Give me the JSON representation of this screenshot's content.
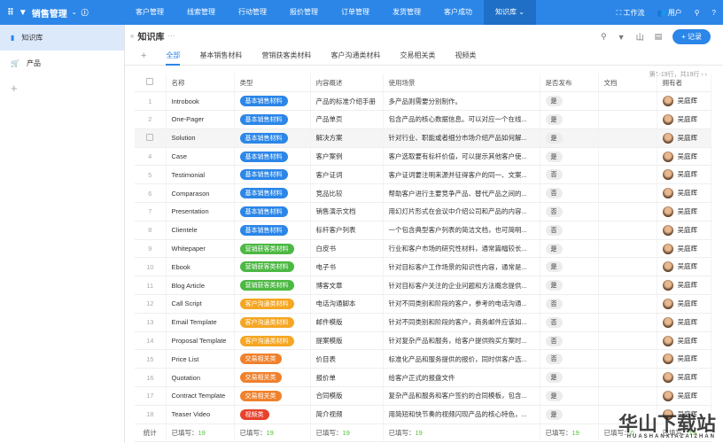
{
  "app": {
    "title": "销售管理",
    "nav": [
      "客户管理",
      "线索管理",
      "行动管理",
      "报价管理",
      "订单管理",
      "发货管理",
      "客户成功",
      "知识库"
    ],
    "active_nav": 7,
    "workflow": "工作流",
    "users": "用户"
  },
  "sidebar": {
    "items": [
      {
        "label": "知识库",
        "icon": "book-icon"
      },
      {
        "label": "产品",
        "icon": "cart-icon"
      }
    ]
  },
  "page": {
    "title": "知识库",
    "add_button": "+ 记录",
    "tabs": [
      "全部",
      "基本销售材料",
      "营销获客类材料",
      "客户沟通类材料",
      "交易相关类",
      "视频类"
    ],
    "pagination": "第1-19行，共19行"
  },
  "table": {
    "columns": [
      "名称",
      "类型",
      "内容概述",
      "使用场景",
      "是否发布",
      "文档",
      "拥有者"
    ],
    "rows": [
      [
        "1",
        "Introbook",
        "基本销售材料",
        "产品的标准介绍手册",
        "多产品则需要分别制作。",
        "是",
        "吴庭辉"
      ],
      [
        "2",
        "One-Pager",
        "基本销售材料",
        "产品单页",
        "包含产品的核心数据信息。可以对应一个在线...",
        "是",
        "吴庭辉"
      ],
      [
        "3",
        "Solution",
        "基本销售材料",
        "解决方案",
        "针对行业、职能或者细分市场介绍产品如何解...",
        "是",
        "吴庭辉"
      ],
      [
        "4",
        "Case",
        "基本销售材料",
        "客户案例",
        "客户选取要有标杆价值，可以提示其他客户使...",
        "是",
        "吴庭辉"
      ],
      [
        "5",
        "Testimonial",
        "基本销售材料",
        "客户证词",
        "客户证词要注明来源并征得客户的同一、文案...",
        "否",
        "吴庭辉"
      ],
      [
        "6",
        "Comparason",
        "基本销售材料",
        "竞品比较",
        "帮助客户进行主要竞争产品、替代产品之间的...",
        "否",
        "吴庭辉"
      ],
      [
        "7",
        "Presentation",
        "基本销售材料",
        "销售演示文档",
        "用幻灯片形式在会议中介绍公司和产品的内容...",
        "否",
        "吴庭辉"
      ],
      [
        "8",
        "Clientele",
        "基本销售材料",
        "标杆客户列表",
        "一个包含典型客户列表的简洁文档，也可简明...",
        "否",
        "吴庭辉"
      ],
      [
        "9",
        "Whitepaper",
        "营销获客类材料",
        "白皮书",
        "行业和客户市场的研究性材料，通常篇幅较长...",
        "是",
        "吴庭辉"
      ],
      [
        "10",
        "Ebook",
        "营销获客类材料",
        "电子书",
        "针对目标客户工作场景的知识性内容，通常是...",
        "是",
        "吴庭辉"
      ],
      [
        "11",
        "Blog Article",
        "营销获客类材料",
        "博客文章",
        "针对目标客户关注的企业问题和方法概念提供...",
        "是",
        "吴庭辉"
      ],
      [
        "12",
        "Call Script",
        "客户沟通类材料",
        "电话沟通脚本",
        "针对不同类别和阶段的客户，参考的电话沟通...",
        "否",
        "吴庭辉"
      ],
      [
        "13",
        "Email Template",
        "客户沟通类材料",
        "邮件模版",
        "针对不同类别和阶段的客户，商务邮件应该如...",
        "否",
        "吴庭辉"
      ],
      [
        "14",
        "Proposal Template",
        "客户沟通类材料",
        "提案模版",
        "针对复杂产品和服务，给客户提供购买方案时...",
        "否",
        "吴庭辉"
      ],
      [
        "15",
        "Price List",
        "交易相关类",
        "价目表",
        "标准化产品和服务提供的报价，同时供客户选...",
        "否",
        "吴庭辉"
      ],
      [
        "16",
        "Quotation",
        "交易相关类",
        "报价单",
        "给客户正式的报盘文件",
        "是",
        "吴庭辉"
      ],
      [
        "17",
        "Contract Template",
        "交易相关类",
        "合同模版",
        "复杂产品和服务和客户签约的合同模板，包含...",
        "是",
        "吴庭辉"
      ],
      [
        "18",
        "Teaser Video",
        "视频类",
        "简介视频",
        "用简短和快节奏的视频闪现产品的核心特色，...",
        "是",
        "吴庭辉"
      ]
    ],
    "footer": {
      "label": "统计",
      "filled_prefix": "已填写：",
      "counts": [
        "19",
        "19",
        "19",
        "19",
        "19",
        "0",
        "19"
      ]
    }
  },
  "tag_colors": {
    "基本销售材料": "#2b86e8",
    "营销获客类材料": "#4cb843",
    "客户沟通类材料": "#f5a623",
    "交易相关类": "#f0812c",
    "视频类": "#e8412c"
  },
  "watermark": "华山下载站 HUASHANXIAZAIZHAN"
}
